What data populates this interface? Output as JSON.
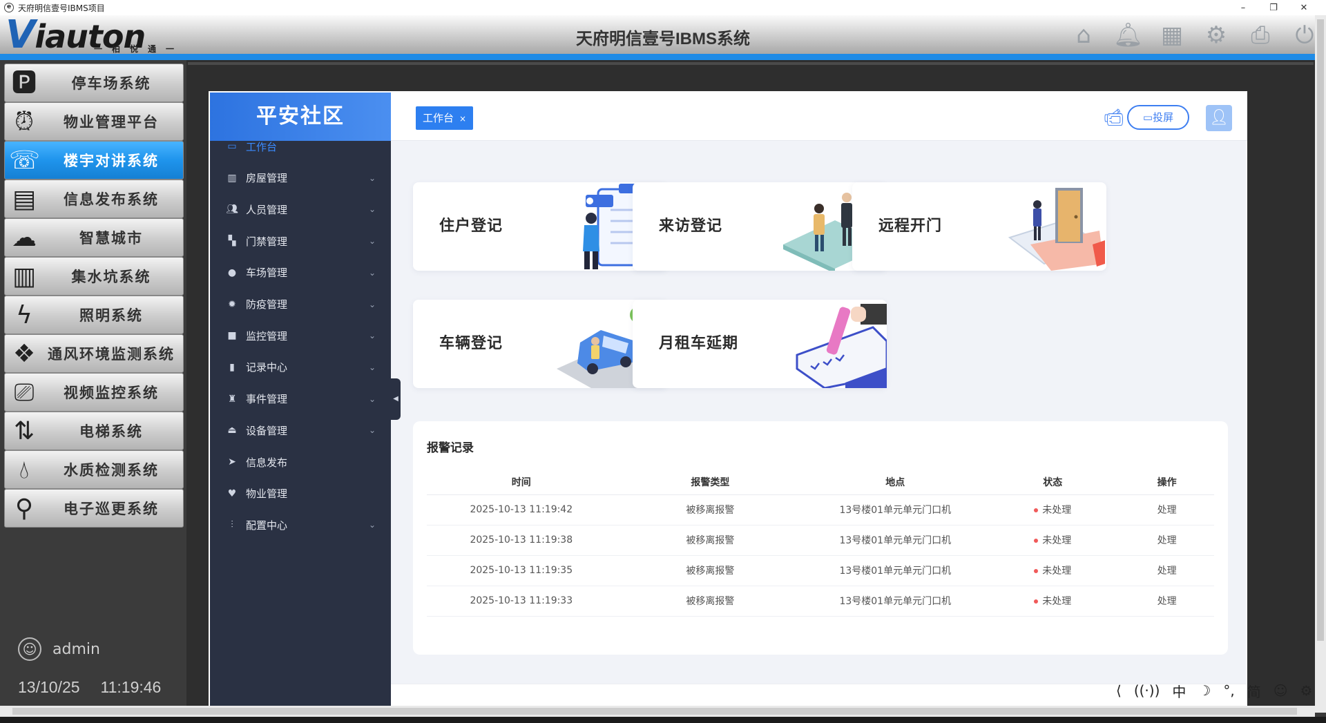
{
  "window": {
    "title": "天府明信壹号IBMS项目",
    "app_icon": "e",
    "controls": [
      "–",
      "❐",
      "✕"
    ]
  },
  "header": {
    "logo_main_v": "V",
    "logo_main_rest": "iauton",
    "logo_sub": "一柏悦通一",
    "title": "天府明信壹号IBMS系统",
    "icons": [
      "home-icon",
      "bell-icon",
      "calendar-icon",
      "gear-icon",
      "printer-icon",
      "power-icon"
    ]
  },
  "sysmenu": {
    "items": [
      {
        "label": "停车场系统",
        "icon": "parking-icon",
        "active": false
      },
      {
        "label": "物业管理平台",
        "icon": "alarm-clock-icon",
        "active": false
      },
      {
        "label": "楼宇对讲系统",
        "icon": "intercom-icon",
        "active": true
      },
      {
        "label": "信息发布系统",
        "icon": "info-board-icon",
        "active": false
      },
      {
        "label": "智慧城市",
        "icon": "city-cloud-icon",
        "active": false
      },
      {
        "label": "集水坑系统",
        "icon": "sump-icon",
        "active": false
      },
      {
        "label": "照明系统",
        "icon": "lighting-icon",
        "active": false
      },
      {
        "label": "通风环境监测系统",
        "icon": "ventilation-icon",
        "active": false
      },
      {
        "label": "视频监控系统",
        "icon": "camera-icon",
        "active": false
      },
      {
        "label": "电梯系统",
        "icon": "elevator-icon",
        "active": false
      },
      {
        "label": "水质检测系统",
        "icon": "water-drop-icon",
        "active": false
      },
      {
        "label": "电子巡更系统",
        "icon": "patrol-icon",
        "active": false
      }
    ],
    "user": "admin",
    "date": "13/10/25",
    "time": "11:19:46"
  },
  "web": {
    "brand": "平安社区",
    "nav": [
      {
        "label": "工作台",
        "icon": "dashboard-icon",
        "active": true,
        "has_children": false
      },
      {
        "label": "房屋管理",
        "icon": "building-icon",
        "active": false,
        "has_children": true
      },
      {
        "label": "人员管理",
        "icon": "people-icon",
        "active": false,
        "has_children": true
      },
      {
        "label": "门禁管理",
        "icon": "door-access-icon",
        "active": false,
        "has_children": true
      },
      {
        "label": "车场管理",
        "icon": "location-pin-icon",
        "active": false,
        "has_children": true
      },
      {
        "label": "防疫管理",
        "icon": "virus-icon",
        "active": false,
        "has_children": true
      },
      {
        "label": "监控管理",
        "icon": "video-icon",
        "active": false,
        "has_children": true
      },
      {
        "label": "记录中心",
        "icon": "record-icon",
        "active": false,
        "has_children": true
      },
      {
        "label": "事件管理",
        "icon": "siren-icon",
        "active": false,
        "has_children": true
      },
      {
        "label": "设备管理",
        "icon": "device-icon",
        "active": false,
        "has_children": true
      },
      {
        "label": "信息发布",
        "icon": "send-icon",
        "active": false,
        "has_children": false
      },
      {
        "label": "物业管理",
        "icon": "heart-icon",
        "active": false,
        "has_children": false
      },
      {
        "label": "配置中心",
        "icon": "sliders-icon",
        "active": false,
        "has_children": true
      }
    ],
    "tab": {
      "label": "工作台",
      "close": "×"
    },
    "project_button": "投屏",
    "cards": [
      {
        "label": "住户登记",
        "icon": "clipboard-person-illustration"
      },
      {
        "label": "来访登记",
        "icon": "handshake-illustration"
      },
      {
        "label": "远程开门",
        "icon": "remote-door-illustration"
      },
      {
        "label": "车辆登记",
        "icon": "car-parking-illustration"
      },
      {
        "label": "月租车延期",
        "icon": "contract-signing-illustration"
      }
    ],
    "alarm": {
      "title": "报警记录",
      "columns": [
        "时间",
        "报警类型",
        "地点",
        "状态",
        "操作"
      ],
      "rows": [
        {
          "time": "2025-10-13 11:19:42",
          "type": "被移离报警",
          "location": "13号楼01单元单元门口机",
          "status": "未处理",
          "action": "处理"
        },
        {
          "time": "2025-10-13 11:19:38",
          "type": "被移离报警",
          "location": "13号楼01单元单元门口机",
          "status": "未处理",
          "action": "处理"
        },
        {
          "time": "2025-10-13 11:19:35",
          "type": "被移离报警",
          "location": "13号楼01单元单元门口机",
          "status": "未处理",
          "action": "处理"
        },
        {
          "time": "2025-10-13 11:19:33",
          "type": "被移离报警",
          "location": "13号楼01单元单元门口机",
          "status": "未处理",
          "action": "处理"
        }
      ]
    }
  },
  "tray": {
    "ime_lang": "中",
    "ime_mode": "简",
    "icons": [
      "share-icon",
      "broadcast-icon",
      "moon-icon",
      "punctuation-icon",
      "emoji-icon",
      "settings-icon"
    ]
  },
  "colors": {
    "accent": "#1f8be6",
    "active_menu": "#1f94ec",
    "nav_bg": "#2a3143",
    "brand_blue": "#2d7ff0",
    "alarm_dot": "#f05a5a"
  }
}
